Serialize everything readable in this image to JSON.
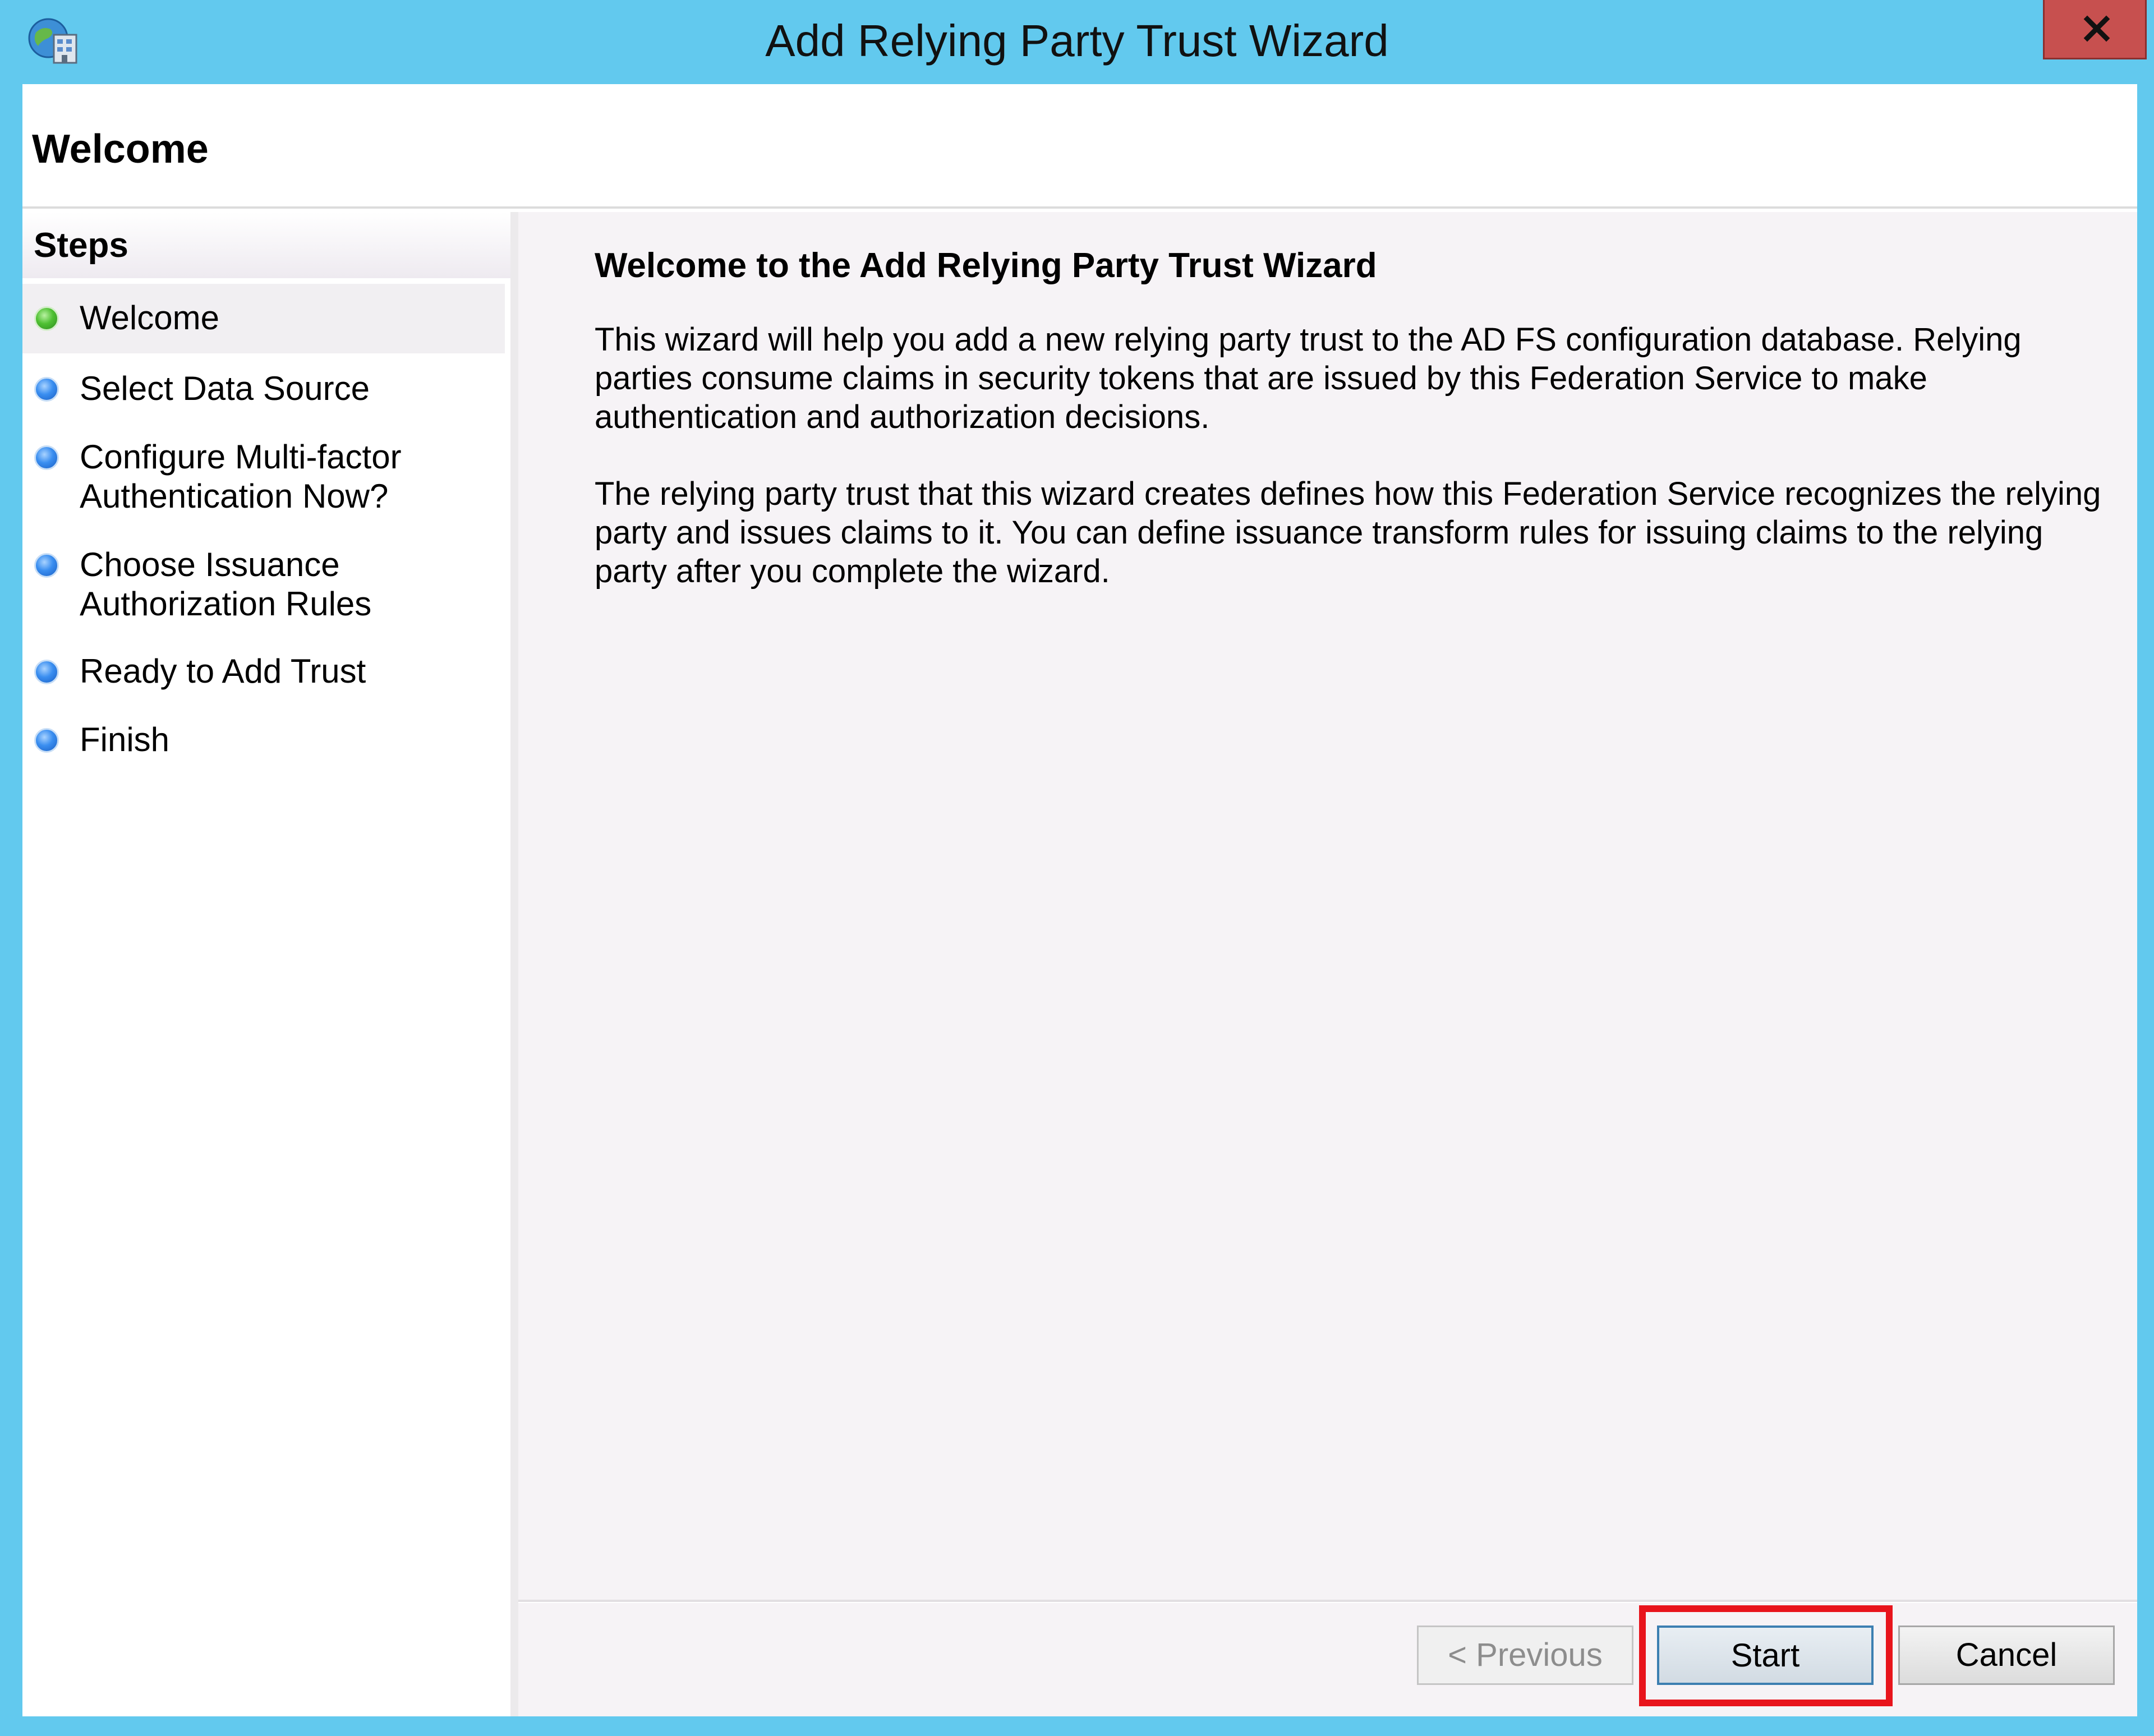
{
  "window": {
    "title": "Add Relying Party Trust Wizard",
    "close_glyph": "X"
  },
  "header": {
    "title": "Welcome"
  },
  "steps": {
    "title": "Steps",
    "items": [
      {
        "label": "Welcome",
        "status": "current"
      },
      {
        "label": "Select Data Source",
        "status": "pending"
      },
      {
        "label": "Configure Multi-factor Authentication Now?",
        "status": "pending"
      },
      {
        "label": "Choose Issuance Authorization Rules",
        "status": "pending"
      },
      {
        "label": "Ready to Add Trust",
        "status": "pending"
      },
      {
        "label": "Finish",
        "status": "pending"
      }
    ]
  },
  "content": {
    "title": "Welcome to the Add Relying Party Trust Wizard",
    "paragraph_1": "This wizard will help you add a new relying party trust to the AD FS configuration database.  Relying parties consume claims in security tokens that are issued by this Federation Service to make authentication and authorization decisions.",
    "paragraph_2": "The relying party trust that this wizard creates defines how this Federation Service recognizes the relying party and issues claims to it. You can define issuance transform rules for issuing claims to the relying party after you complete the wizard."
  },
  "buttons": {
    "previous": "< Previous",
    "start": "Start",
    "cancel": "Cancel"
  },
  "colors": {
    "title_bar": "#62c9ee",
    "close_button": "#c7504f",
    "highlight": "#e8141c",
    "current_step_dot": "#4fc033",
    "pending_step_dot": "#3a8ef0"
  },
  "icons": {
    "app": "adfs-globe-icon",
    "close": "close-icon",
    "current_step": "green-dot-icon",
    "pending_step": "blue-dot-icon"
  }
}
